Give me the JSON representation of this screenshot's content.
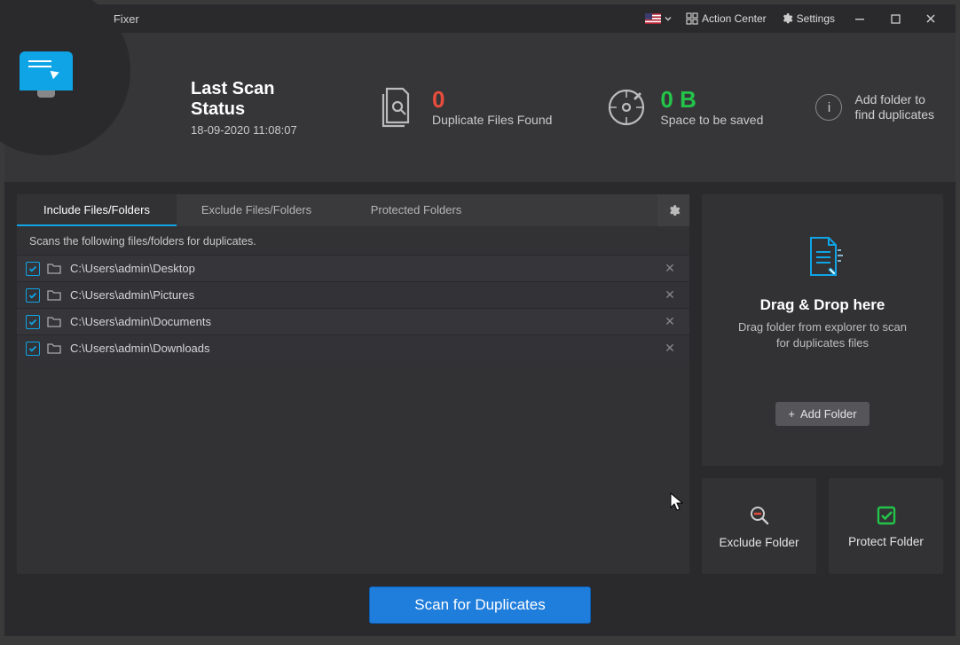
{
  "titlebar": {
    "app_title": "Duplicate Files Fixer",
    "action_center": "Action Center",
    "settings": "Settings"
  },
  "status": {
    "last_scan_title_l1": "Last Scan",
    "last_scan_title_l2": "Status",
    "timestamp": "18-09-2020 11:08:07",
    "metric1_value": "0",
    "metric1_label": "Duplicate Files Found",
    "metric2_value": "0 B",
    "metric2_label": "Space to be saved",
    "info_add_l1": "Add folder to",
    "info_add_l2": "find duplicates"
  },
  "tabs": {
    "include": "Include Files/Folders",
    "exclude": "Exclude Files/Folders",
    "protected": "Protected Folders",
    "description": "Scans the following files/folders for duplicates."
  },
  "files": [
    {
      "path": "C:\\Users\\admin\\Desktop"
    },
    {
      "path": "C:\\Users\\admin\\Pictures"
    },
    {
      "path": "C:\\Users\\admin\\Documents"
    },
    {
      "path": "C:\\Users\\admin\\Downloads"
    }
  ],
  "drop": {
    "title": "Drag & Drop here",
    "subtitle_l1": "Drag folder from explorer to scan",
    "subtitle_l2": "for duplicates files",
    "add_folder": "Add Folder"
  },
  "actions": {
    "exclude_folder": "Exclude Folder",
    "protect_folder": "Protect Folder"
  },
  "footer": {
    "scan": "Scan for Duplicates"
  }
}
